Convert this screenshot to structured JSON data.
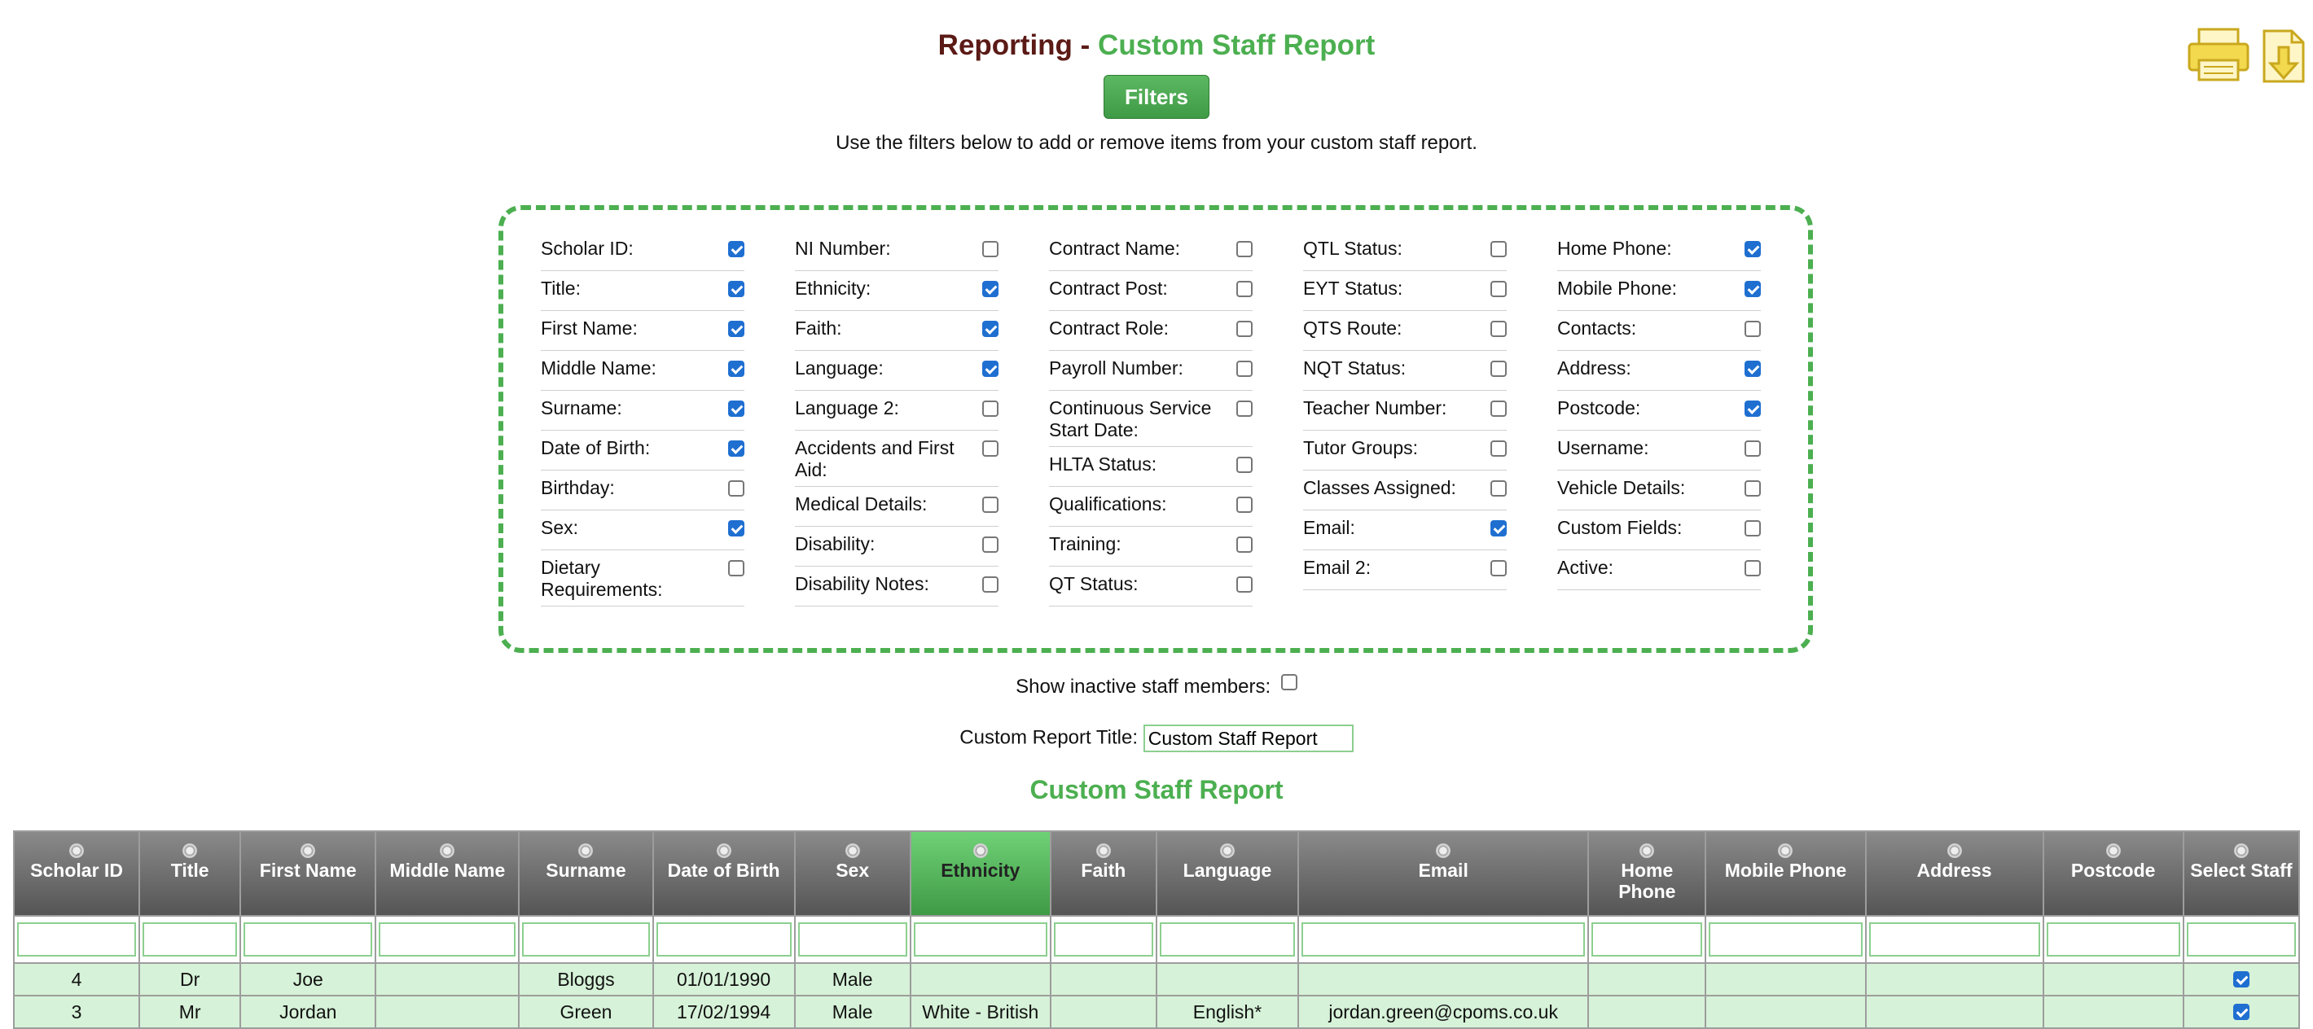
{
  "title": {
    "prefix": "Reporting -",
    "main": "Custom Staff Report"
  },
  "filters_button": "Filters",
  "instructions": "Use the filters below to add or remove items from your custom staff report.",
  "filter_columns": [
    [
      {
        "label": "Scholar ID:",
        "checked": true
      },
      {
        "label": "Title:",
        "checked": true
      },
      {
        "label": "First Name:",
        "checked": true
      },
      {
        "label": "Middle Name:",
        "checked": true
      },
      {
        "label": "Surname:",
        "checked": true
      },
      {
        "label": "Date of Birth:",
        "checked": true
      },
      {
        "label": "Birthday:",
        "checked": false
      },
      {
        "label": "Sex:",
        "checked": true
      },
      {
        "label": "Dietary Requirements:",
        "checked": false
      }
    ],
    [
      {
        "label": "NI Number:",
        "checked": false
      },
      {
        "label": "Ethnicity:",
        "checked": true
      },
      {
        "label": "Faith:",
        "checked": true
      },
      {
        "label": "Language:",
        "checked": true
      },
      {
        "label": "Language 2:",
        "checked": false
      },
      {
        "label": "Accidents and First Aid:",
        "checked": false
      },
      {
        "label": "Medical Details:",
        "checked": false
      },
      {
        "label": "Disability:",
        "checked": false
      },
      {
        "label": "Disability Notes:",
        "checked": false
      }
    ],
    [
      {
        "label": "Contract Name:",
        "checked": false
      },
      {
        "label": "Contract Post:",
        "checked": false
      },
      {
        "label": "Contract Role:",
        "checked": false
      },
      {
        "label": "Payroll Number:",
        "checked": false
      },
      {
        "label": "Continuous Service Start Date:",
        "checked": false
      },
      {
        "label": "HLTA Status:",
        "checked": false
      },
      {
        "label": "Qualifications:",
        "checked": false
      },
      {
        "label": "Training:",
        "checked": false
      },
      {
        "label": "QT Status:",
        "checked": false
      }
    ],
    [
      {
        "label": "QTL Status:",
        "checked": false
      },
      {
        "label": "EYT Status:",
        "checked": false
      },
      {
        "label": "QTS Route:",
        "checked": false
      },
      {
        "label": "NQT Status:",
        "checked": false
      },
      {
        "label": "Teacher Number:",
        "checked": false
      },
      {
        "label": "Tutor Groups:",
        "checked": false
      },
      {
        "label": "Classes Assigned:",
        "checked": false
      },
      {
        "label": "Email:",
        "checked": true
      },
      {
        "label": "Email 2:",
        "checked": false
      }
    ],
    [
      {
        "label": "Home Phone:",
        "checked": true
      },
      {
        "label": "Mobile Phone:",
        "checked": true
      },
      {
        "label": "Contacts:",
        "checked": false
      },
      {
        "label": "Address:",
        "checked": true
      },
      {
        "label": "Postcode:",
        "checked": true
      },
      {
        "label": "Username:",
        "checked": false
      },
      {
        "label": "Vehicle Details:",
        "checked": false
      },
      {
        "label": "Custom Fields:",
        "checked": false
      },
      {
        "label": "Active:",
        "checked": false
      }
    ]
  ],
  "show_inactive": {
    "label": "Show inactive staff members:",
    "checked": false
  },
  "custom_title": {
    "label": "Custom Report Title:",
    "value": "Custom Staff Report"
  },
  "report_heading": "Custom Staff Report",
  "table": {
    "columns": [
      "Scholar ID",
      "Title",
      "First Name",
      "Middle Name",
      "Surname",
      "Date of Birth",
      "Sex",
      "Ethnicity",
      "Faith",
      "Language",
      "Email",
      "Home Phone",
      "Mobile Phone",
      "Address",
      "Postcode",
      "Select Staff"
    ],
    "highlighted_column": "Ethnicity",
    "rows": [
      {
        "cells": [
          "4",
          "Dr",
          "Joe",
          "",
          "Bloggs",
          "01/01/1990",
          "Male",
          "",
          "",
          "",
          "",
          "",
          "",
          "",
          ""
        ],
        "selected": true
      },
      {
        "cells": [
          "3",
          "Mr",
          "Jordan",
          "",
          "Green",
          "17/02/1994",
          "Male",
          "White - British",
          "",
          "English*",
          "jordan.green@cpoms.co.uk",
          "",
          "",
          "",
          ""
        ],
        "selected": true
      }
    ]
  },
  "colors": {
    "accent_green": "#4caf50",
    "title_dark": "#5b1a16",
    "row_bg": "#d6f2d8",
    "icon_yellow": "#f2d94e"
  }
}
